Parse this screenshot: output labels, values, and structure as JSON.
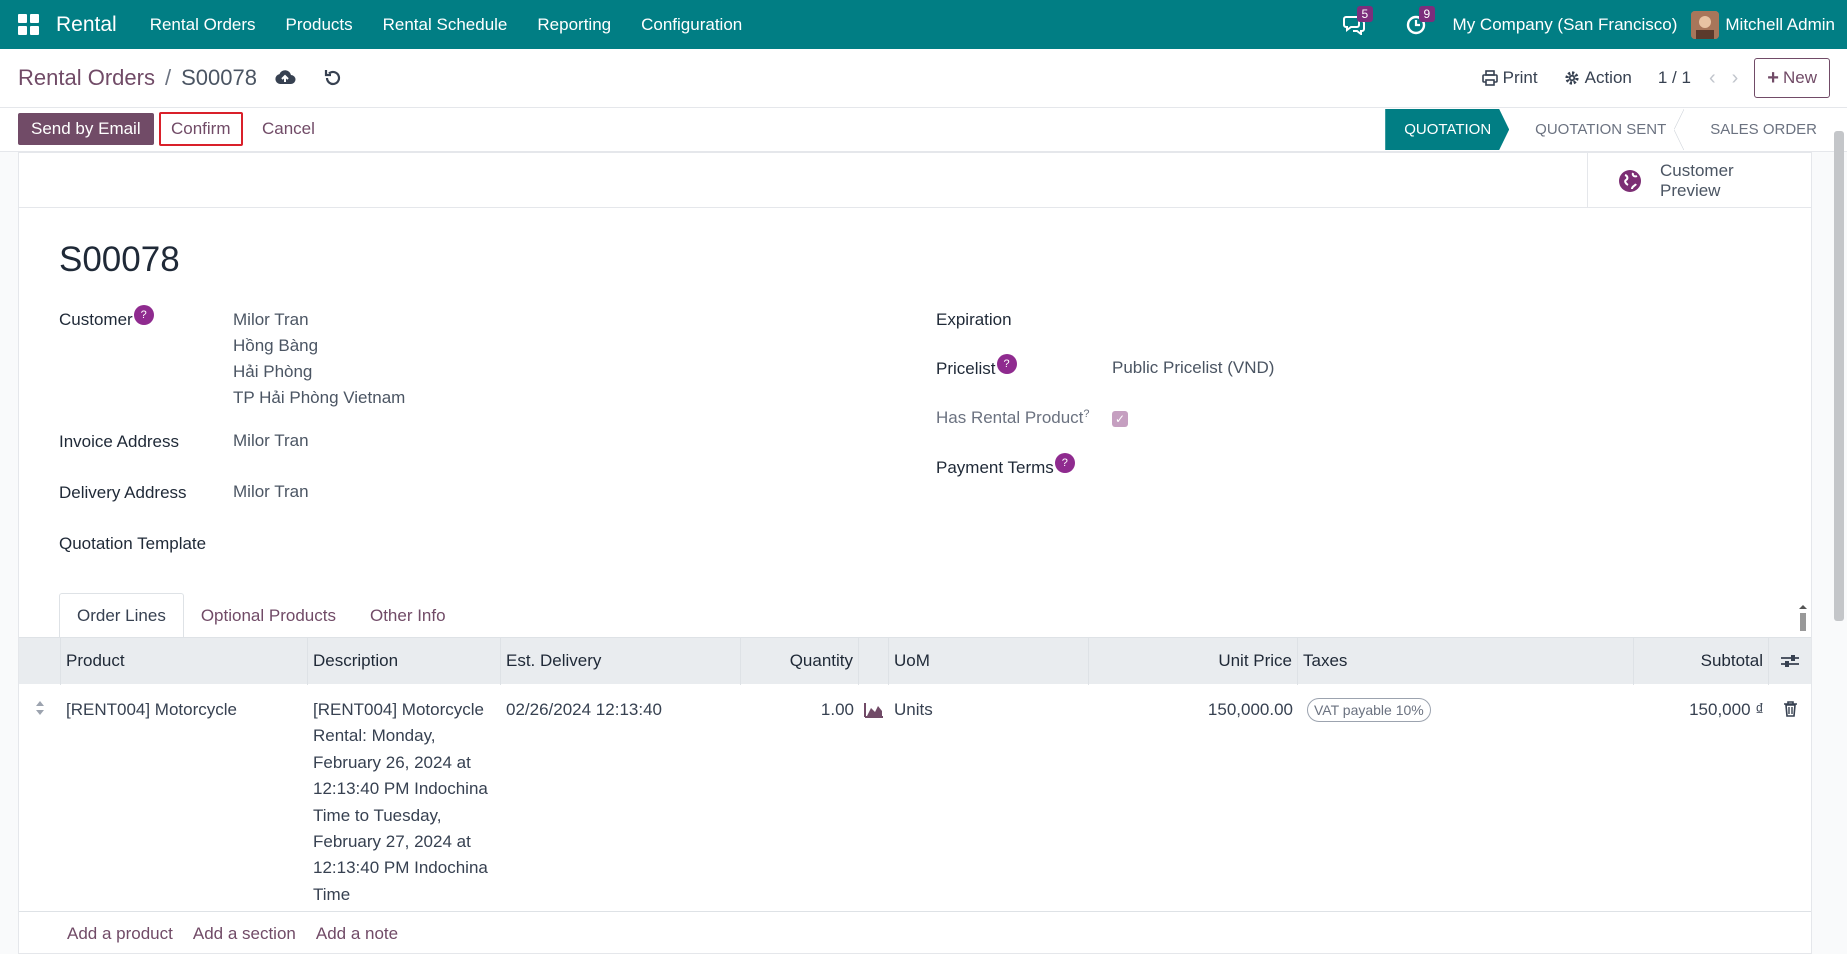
{
  "topbar": {
    "app_name": "Rental",
    "menu": [
      "Rental Orders",
      "Products",
      "Rental Schedule",
      "Reporting",
      "Configuration"
    ],
    "messages_count": "5",
    "activities_count": "9",
    "company": "My Company (San Francisco)",
    "user": "Mitchell Admin"
  },
  "control": {
    "breadcrumb_parent": "Rental Orders",
    "breadcrumb_separator": "/",
    "breadcrumb_current": "S00078",
    "print_label": "Print",
    "action_label": "Action",
    "pager": "1 / 1",
    "new_label": "New"
  },
  "statusbar": {
    "send_email_label": "Send by Email",
    "confirm_label": "Confirm",
    "cancel_label": "Cancel",
    "stages": [
      "QUOTATION",
      "QUOTATION SENT",
      "SALES ORDER"
    ],
    "active_stage": "QUOTATION"
  },
  "sheet": {
    "customer_preview_label": "Customer Preview",
    "title": "S00078",
    "fields": {
      "customer_label": "Customer",
      "customer_lines": [
        "Milor Tran",
        "Hồng Bàng",
        "Hải Phòng",
        "TP Hải Phòng Vietnam"
      ],
      "invoice_address_label": "Invoice Address",
      "invoice_address": "Milor Tran",
      "delivery_address_label": "Delivery Address",
      "delivery_address": "Milor Tran",
      "quotation_template_label": "Quotation Template",
      "expiration_label": "Expiration",
      "pricelist_label": "Pricelist",
      "pricelist": "Public Pricelist (VND)",
      "has_rental_label": "Has Rental Product",
      "has_rental_checked": true,
      "payment_terms_label": "Payment Terms"
    },
    "help_mark": "?"
  },
  "tabs": [
    "Order Lines",
    "Optional Products",
    "Other Info"
  ],
  "order_lines": {
    "columns": [
      "Product",
      "Description",
      "Est. Delivery",
      "Quantity",
      "UoM",
      "Unit Price",
      "Taxes",
      "Subtotal"
    ],
    "rows": [
      {
        "product": "[RENT004] Motorcycle",
        "description": "[RENT004] Motorcycle Rental: Monday, February 26, 2024 at 12:13:40 PM Indochina Time to Tuesday, February 27, 2024 at 12:13:40 PM Indochina Time",
        "est_delivery": "02/26/2024 12:13:40",
        "quantity": "1.00",
        "uom": "Units",
        "unit_price": "150,000.00",
        "tax": "VAT payable 10%",
        "subtotal": "150,000 ₫"
      }
    ],
    "add_links": [
      "Add a product",
      "Add a section",
      "Add a note"
    ]
  },
  "colors": {
    "topbar": "#017e84",
    "primary": "#714b67",
    "highlight_border": "#d9202a"
  }
}
